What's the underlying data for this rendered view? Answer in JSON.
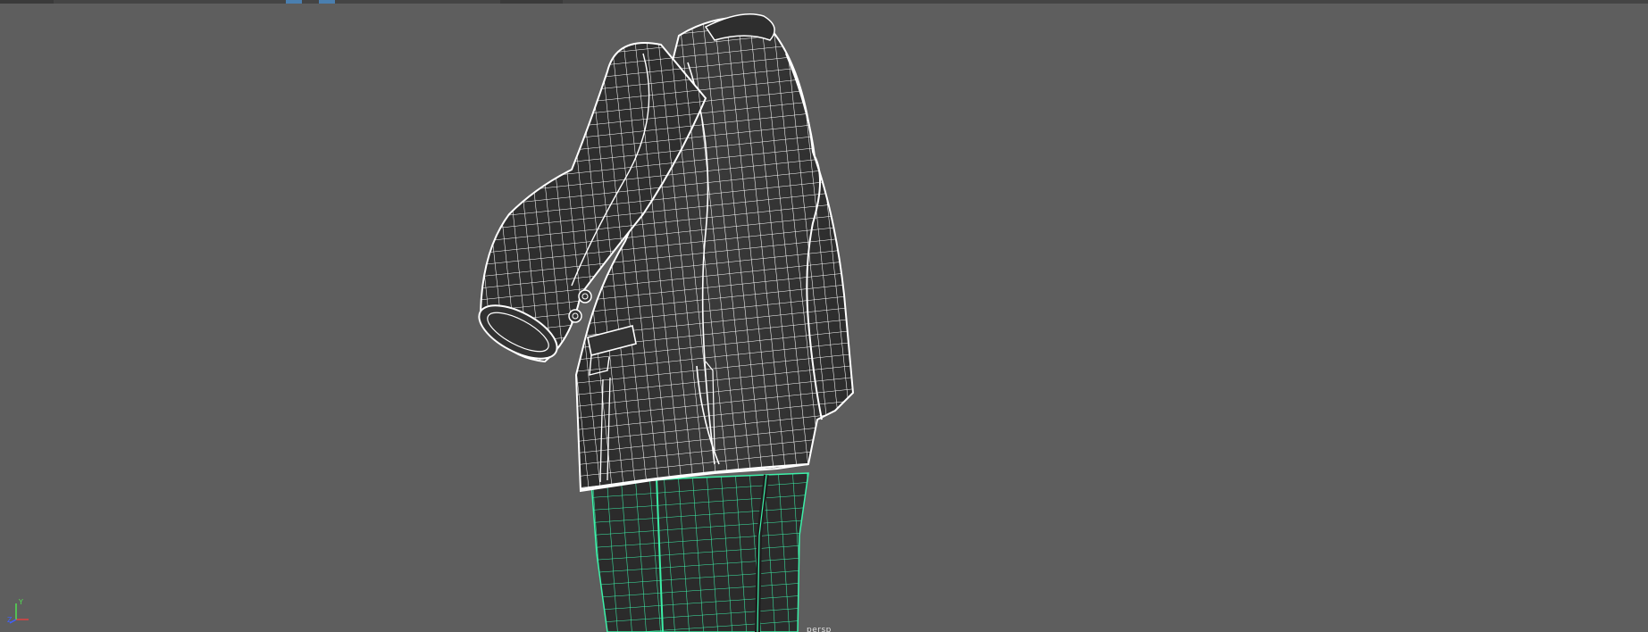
{
  "viewport": {
    "camera_label": "persp",
    "background": "#5e5e5e",
    "wire_color": "#ffffff",
    "selected_wire_color": "#3cf0a8"
  },
  "axis_gizmo": {
    "y_label": "Y",
    "z_label": "Z",
    "x_color": "#e04040",
    "y_color": "#50e050",
    "z_color": "#4060ff"
  },
  "objects": [
    {
      "name": "jacket",
      "display": "wireframe",
      "icon": "jacket-mesh"
    },
    {
      "name": "pants",
      "display": "wireframe-selected",
      "icon": "pants-mesh"
    }
  ]
}
